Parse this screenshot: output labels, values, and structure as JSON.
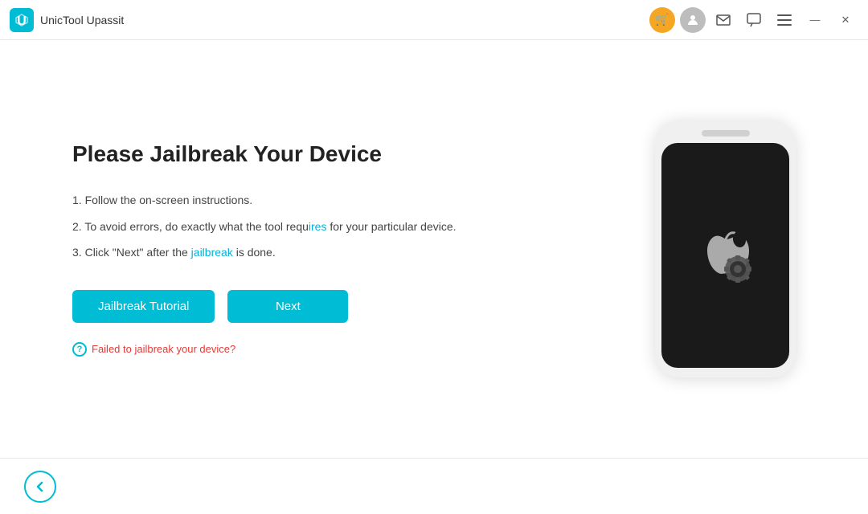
{
  "titleBar": {
    "appTitle": "UnicTool Upassit",
    "cartIcon": "🛒",
    "profileIcon": "👤",
    "mailIcon": "✉",
    "chatIcon": "💬",
    "menuIcon": "☰",
    "minimizeIcon": "—",
    "closeIcon": "✕"
  },
  "main": {
    "heading": "Please Jailbreak Your Device",
    "instructions": [
      "Follow the on-screen instructions.",
      "To avoid errors, do exactly what the tool requires for your particular device.",
      "Click \"Next\" after the jailbreak is done."
    ],
    "instructionLinks": [
      "jailbreak"
    ],
    "buttons": {
      "tutorial": "Jailbreak Tutorial",
      "next": "Next"
    },
    "helpLink": "Failed to jailbreak your device?"
  },
  "bottomBar": {
    "backLabel": "←"
  }
}
